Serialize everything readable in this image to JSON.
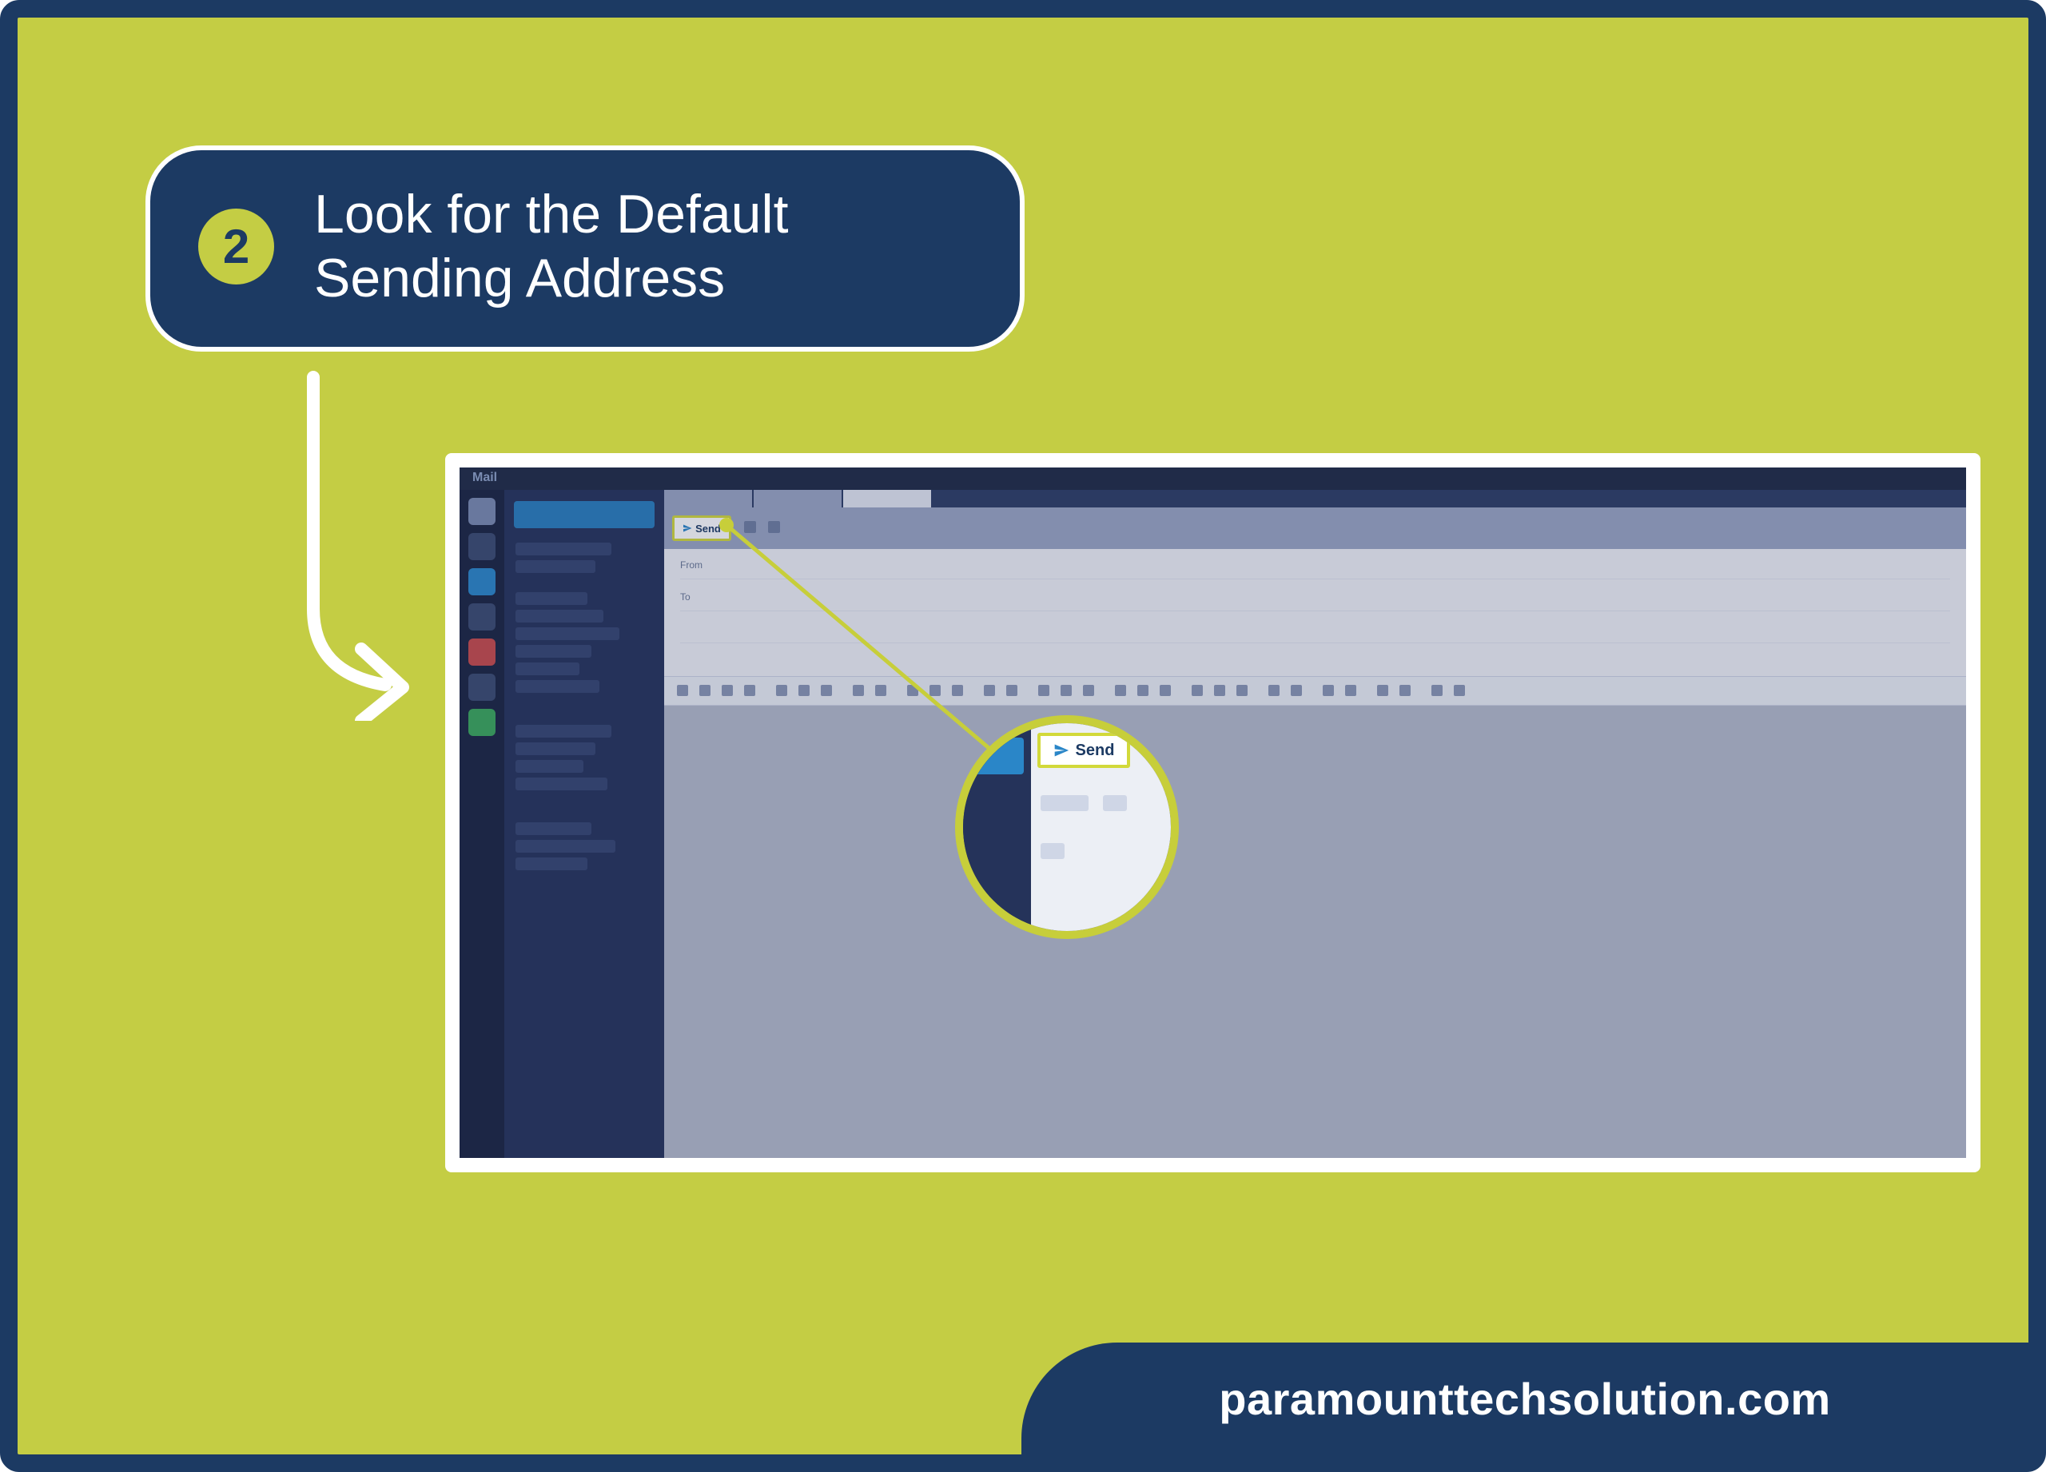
{
  "step": {
    "number": "2",
    "title": "Look for the Default\nSending Address"
  },
  "footer": {
    "domain": "paramounttechsolution.com"
  },
  "mail": {
    "appTitle": "Mail",
    "sendLabel": "Send",
    "fields": {
      "from": "From",
      "to": "To"
    }
  },
  "colors": {
    "accent": "#c4cd44",
    "brand": "#1c3a63"
  }
}
